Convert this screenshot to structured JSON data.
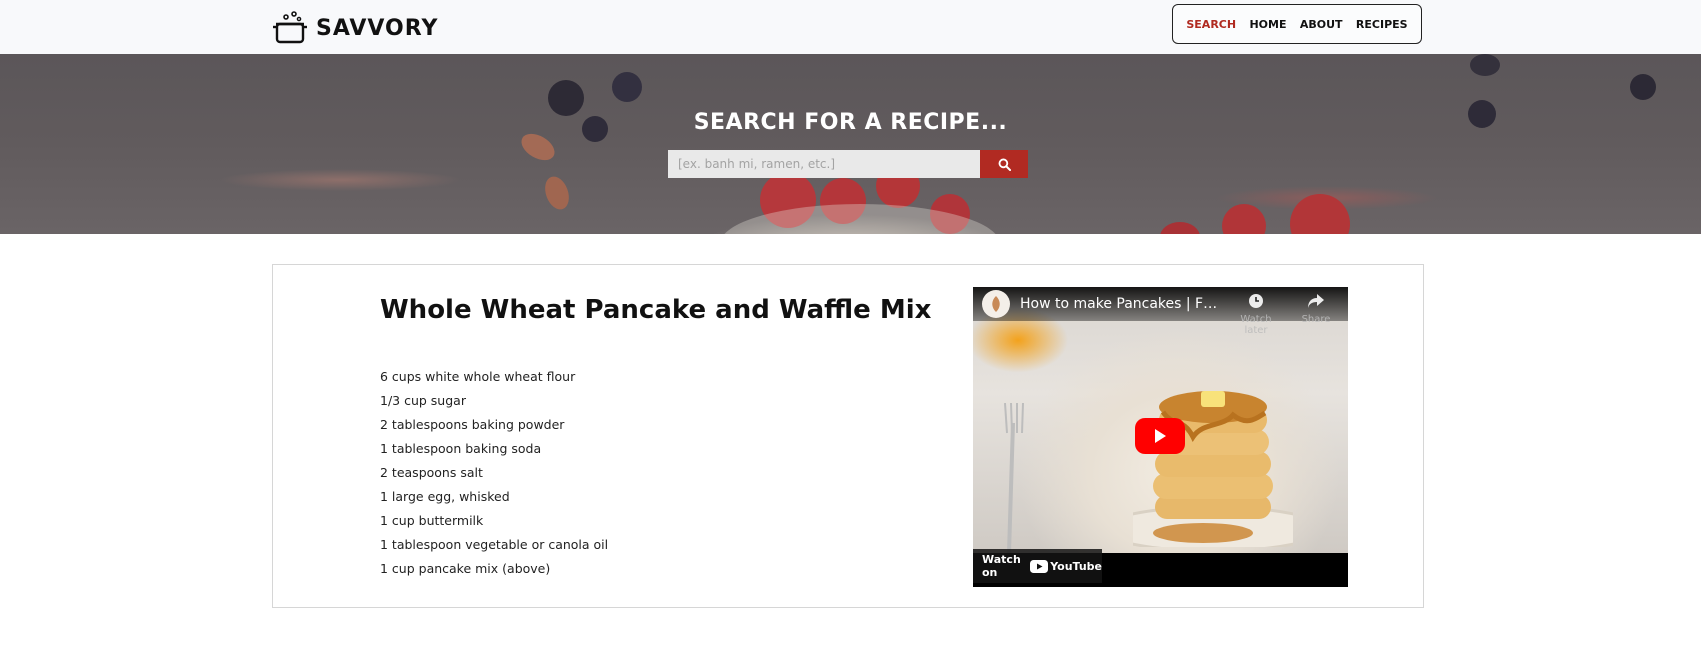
{
  "brand": {
    "name": "SAVVORY"
  },
  "nav": {
    "items": [
      {
        "label": "SEARCH",
        "active": true
      },
      {
        "label": "HOME",
        "active": false
      },
      {
        "label": "ABOUT",
        "active": false
      },
      {
        "label": "RECIPES",
        "active": false
      }
    ]
  },
  "hero": {
    "title": "SEARCH FOR A RECIPE...",
    "search_placeholder": "[ex. banh mi, ramen, etc.]",
    "search_value": ""
  },
  "recipe": {
    "title": "Whole Wheat Pancake and Waffle Mix",
    "ingredients": [
      "6 cups white whole wheat flour",
      "1/3 cup sugar",
      "2 tablespoons baking powder",
      "1 tablespoon baking soda",
      "2 teaspoons salt",
      "1 large egg, whisked",
      "1 cup buttermilk",
      "1 tablespoon vegetable or canola oil",
      "1 cup pancake mix (above)"
    ]
  },
  "video": {
    "title": "How to make Pancakes | Fluffy ...",
    "watch_later_label": "Watch later",
    "share_label": "Share",
    "watch_on_label": "Watch on",
    "platform_label": "YouTube"
  },
  "colors": {
    "accent": "#b02a20",
    "search_button": "#b12a22",
    "play_button": "#ff0000"
  }
}
